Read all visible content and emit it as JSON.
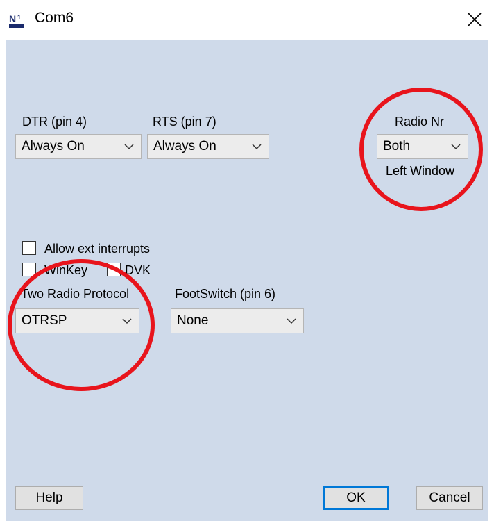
{
  "window": {
    "title": "Com6",
    "app_icon": "n1mm-logo-icon",
    "close_icon": "close-icon"
  },
  "dtr": {
    "label": "DTR (pin 4)",
    "value": "Always On"
  },
  "rts": {
    "label": "RTS (pin 7)",
    "value": "Always On"
  },
  "radio_nr": {
    "label": "Radio Nr",
    "value": "Both",
    "note": "Left Window"
  },
  "checkboxes": {
    "allow_ext_interrupts": {
      "label": "Allow ext interrupts",
      "checked": false
    },
    "winkey": {
      "label": "WinKey",
      "checked": false
    },
    "dvk": {
      "label": "DVK",
      "checked": false
    }
  },
  "two_radio_protocol": {
    "label": "Two Radio Protocol",
    "value": "OTRSP"
  },
  "footswitch": {
    "label": "FootSwitch (pin 6)",
    "value": "None"
  },
  "buttons": {
    "help": "Help",
    "ok": "OK",
    "cancel": "Cancel"
  },
  "colors": {
    "client_background": "#cfdaea",
    "annotation_circle": "#e8141c",
    "default_button_border": "#0078d7"
  }
}
